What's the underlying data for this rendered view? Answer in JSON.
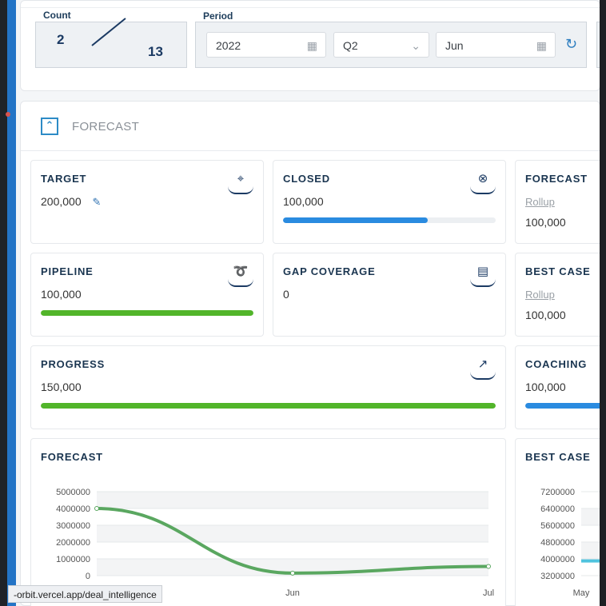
{
  "count": {
    "label": "Count",
    "current": "2",
    "total": "13"
  },
  "period": {
    "label": "Period",
    "year": "2022",
    "quarter": "Q2",
    "month": "Jun",
    "icons": {
      "calendar": "calendar-icon",
      "chevron": "chevron-down-icon",
      "refresh": "refresh-icon"
    }
  },
  "forecast_section": {
    "title": "FORECAST"
  },
  "tiles": {
    "target": {
      "title": "TARGET",
      "value": "200,000"
    },
    "closed": {
      "title": "CLOSED",
      "value": "100,000",
      "progress": 0.68
    },
    "forecast": {
      "title": "FORECAST",
      "sub": "Rollup",
      "value": "100,000"
    },
    "pipeline": {
      "title": "PIPELINE",
      "value": "100,000",
      "progress": 1.0
    },
    "gap_coverage": {
      "title": "GAP COVERAGE",
      "value": "0"
    },
    "best_case": {
      "title": "BEST CASE",
      "sub": "Rollup",
      "value": "100,000"
    },
    "progress": {
      "title": "PROGRESS",
      "value": "150,000",
      "progress": 1.0
    },
    "coaching": {
      "title": "COACHING",
      "value": "100,000",
      "progress": 1.0
    }
  },
  "colors": {
    "blue_bar": "#2a8be0",
    "green_bar": "#52b52a",
    "line": "#5aa760",
    "best_case_line": "#4fc3de"
  },
  "chart_data": [
    {
      "type": "line",
      "title": "FORECAST",
      "x": [
        "May",
        "Jun",
        "Jul"
      ],
      "tick_labels_shown": [
        "",
        "Jun",
        "Jul"
      ],
      "series": [
        {
          "values": [
            4000000,
            150000,
            550000
          ]
        }
      ],
      "yticks": [
        0,
        1000000,
        2000000,
        3000000,
        4000000,
        5000000
      ],
      "ylim": [
        0,
        5000000
      ],
      "grid": true
    },
    {
      "type": "line",
      "title": "BEST CASE",
      "x": [
        "May"
      ],
      "series": [
        {
          "values": [
            3900000
          ]
        }
      ],
      "yticks": [
        3200000,
        4000000,
        4800000,
        5600000,
        6400000,
        7200000
      ],
      "ylim": [
        3200000,
        7200000
      ],
      "grid": true
    }
  ],
  "status_bar": {
    "url": "-orbit.vercel.app/deal_intelligence"
  }
}
